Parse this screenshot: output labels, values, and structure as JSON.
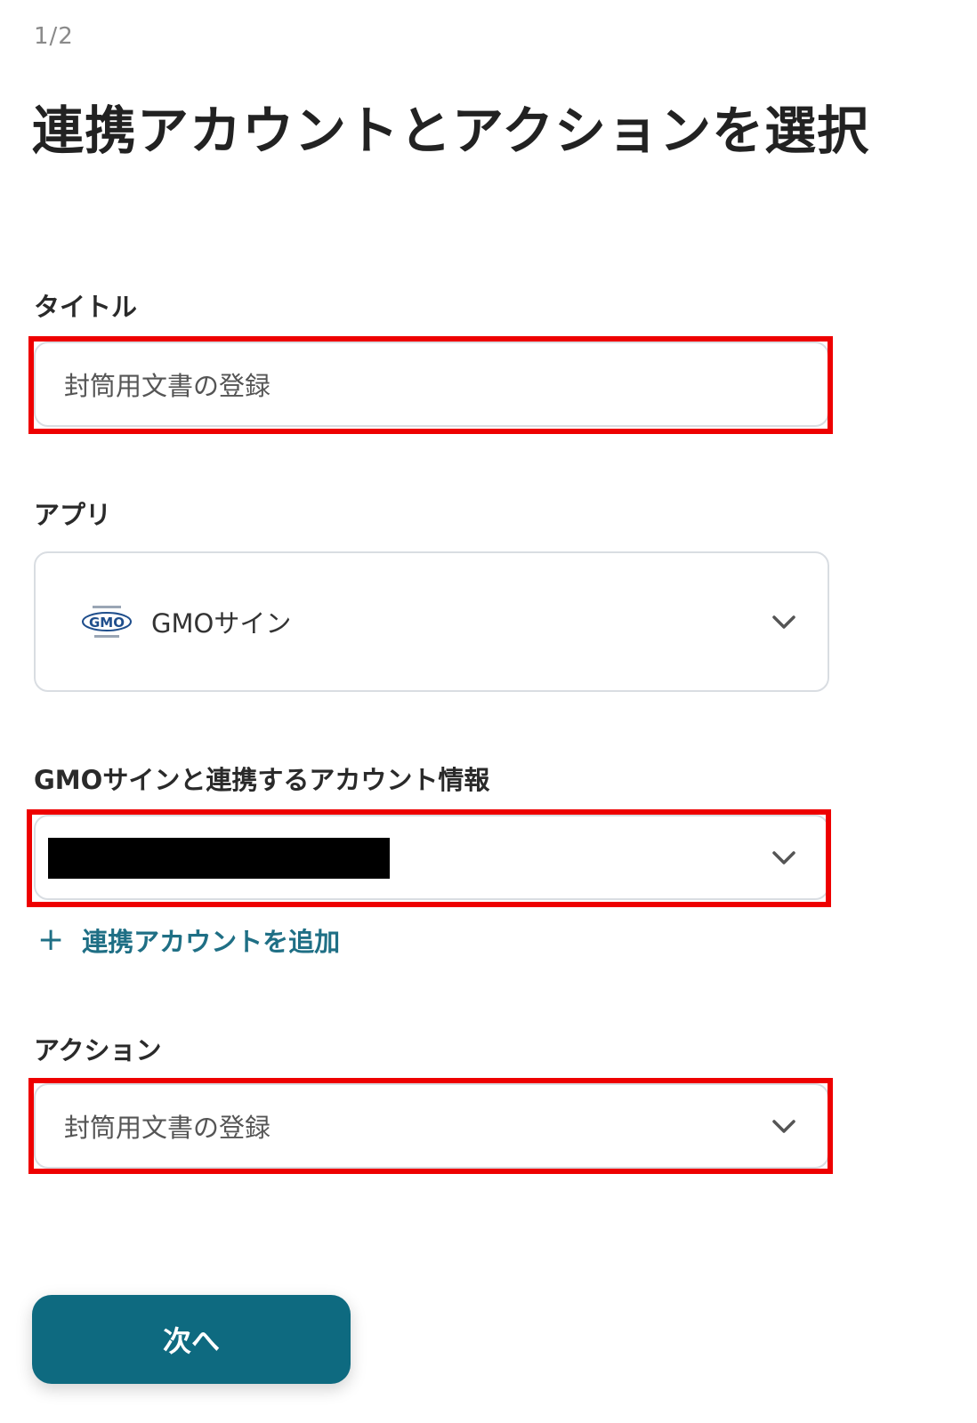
{
  "step": "1/2",
  "title": "連携アカウントとアクションを選択",
  "fields": {
    "title_label": "タイトル",
    "title_value": "封筒用文書の登録",
    "app_label": "アプリ",
    "app_name": "GMOサイン",
    "account_label": "GMOサインと連携するアカウント情報",
    "add_account": "連携アカウントを追加",
    "action_label": "アクション",
    "action_value": "封筒用文書の登録"
  },
  "button": {
    "next": "次へ"
  },
  "colors": {
    "highlight": "#ee0000",
    "accent": "#0e6a80",
    "link": "#1f6f85"
  },
  "icons": {
    "dropdown": "chevron-down-icon",
    "add": "plus-icon",
    "app_logo": "gmo-sign-logo"
  }
}
